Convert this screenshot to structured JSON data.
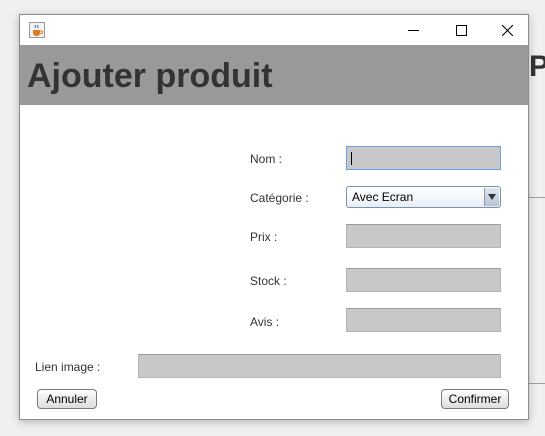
{
  "background": {
    "heading_fragment": "P"
  },
  "window": {
    "minimize_symbol": "—",
    "maximize_symbol": "☐",
    "close_symbol": "✕"
  },
  "header": {
    "title": "Ajouter produit"
  },
  "form": {
    "nom": {
      "label": "Nom :",
      "value": ""
    },
    "categorie": {
      "label": "Catégorie :",
      "selected": "Avec Ecran"
    },
    "prix": {
      "label": "Prix :",
      "value": ""
    },
    "stock": {
      "label": "Stock :",
      "value": ""
    },
    "avis": {
      "label": "Avis :",
      "value": ""
    },
    "lien_image": {
      "label": "Lien image :",
      "value": ""
    }
  },
  "buttons": {
    "cancel": "Annuler",
    "confirm": "Confirmer"
  },
  "icons": {
    "app": "java-cup-icon",
    "dropdown": "chevron-down-icon"
  },
  "colors": {
    "header_bg": "#999999",
    "field_bg": "#c8c8c8",
    "header_text": "#333333"
  }
}
